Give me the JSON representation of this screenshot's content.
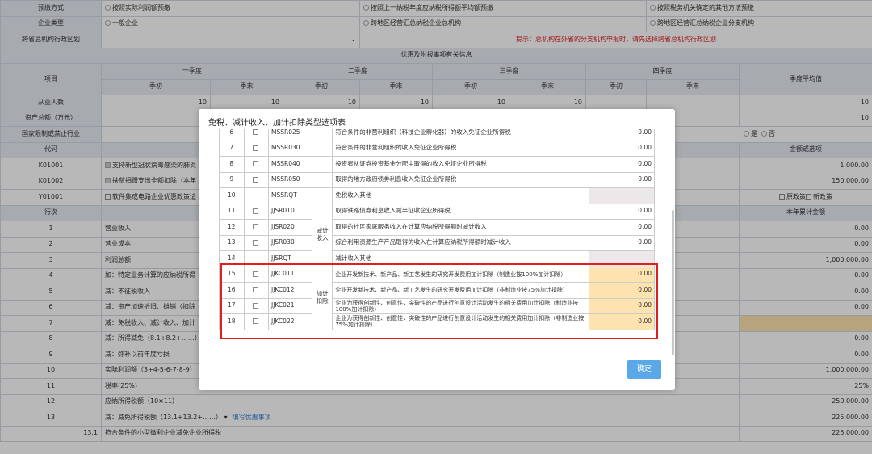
{
  "form": {
    "method_label": "预缴方式",
    "method_opts": [
      "按照实际利润额预缴",
      "按照上一纳税年度应纳税所得额平均额预缴",
      "按照税务机关确定的其他方法预缴"
    ],
    "type_label": "企业类型",
    "type_opts": [
      "一般企业",
      "跨地区经营汇总纳税企业总机构",
      "跨地区经营汇总纳税企业分支机构"
    ],
    "region_label": "跨省总机构行政区划",
    "region_hint": "提示：总机构在外省的分支机构申报时，请先选择跨省总机构行政区划",
    "section_title": "优惠及附报事项有关信息",
    "item_label": "项目",
    "quarters": [
      "一季度",
      "二季度",
      "三季度",
      "四季度"
    ],
    "q_begin": "季初",
    "q_end": "季末",
    "q_avg": "季度平均值",
    "rows": [
      {
        "label": "从业人数",
        "vals": [
          "10",
          "10",
          "10",
          "10",
          "10",
          "10"
        ],
        "avg": "10"
      },
      {
        "label": "资产总额（万元）",
        "vals": [
          "",
          "",
          "",
          "",
          "",
          ""
        ],
        "avg": "10"
      }
    ],
    "restricted_label": "国家限制或禁止行业",
    "restricted_yes": "是",
    "restricted_no": "否",
    "code_label": "代码",
    "amount_label": "金额或选项",
    "pref": [
      {
        "code": "K01001",
        "name": "支持新型冠状病毒感染的肺炎",
        "amt": "1,000.00"
      },
      {
        "code": "K01002",
        "name": "扶贫捐赠支出全额扣除（本年",
        "amt": "150,000.00"
      },
      {
        "code": "Y01001",
        "name": "软件集成电路企业优惠政策适",
        "amt": ""
      }
    ],
    "old_policy": "原政策",
    "new_policy": "新政策",
    "line_label": "行次",
    "cum_label": "本年累计金额",
    "lines": [
      {
        "no": "1",
        "name": "营业收入",
        "amt": "0.00"
      },
      {
        "no": "2",
        "name": "营业成本",
        "amt": "0.00"
      },
      {
        "no": "3",
        "name": "利润总额",
        "amt": "1,000,000.00"
      },
      {
        "no": "4",
        "name": "加：特定业务计算的应纳税所得",
        "amt": "0.00"
      },
      {
        "no": "5",
        "name": "减：不征税收入",
        "amt": "0.00"
      },
      {
        "no": "6",
        "name": "减：资产加速折旧、摊销（扣除",
        "amt": "0.00"
      },
      {
        "no": "7",
        "name": "减：免税收入、减计收入、加计",
        "amt": ""
      },
      {
        "no": "8",
        "name": "减：所得减免（8.1+8.2+……）",
        "amt": "0.00"
      },
      {
        "no": "9",
        "name": "减：弥补以前年度亏损",
        "amt": "0.00"
      },
      {
        "no": "10",
        "name": "实际利润额（3+4-5-6-7-8-9）",
        "amt": "1,000,000.00"
      },
      {
        "no": "11",
        "name": "税率(25%)",
        "amt": "25%"
      },
      {
        "no": "12",
        "name": "应纳所得税额（10×11）",
        "amt": "250,000.00"
      },
      {
        "no": "13",
        "name": "减：减免所得税额（13.1+13.2+……）",
        "amt": "225,000.00"
      },
      {
        "no": "13.1",
        "name": "符合条件的小型微利企业减免企业所得税",
        "amt": "225,000.00"
      }
    ],
    "fill_link": "填写优惠事项"
  },
  "dialog": {
    "title": "免税、减计收入、加计扣除类型选项表",
    "group_reduce": "减计收入",
    "group_add": "加计扣除",
    "confirm": "确定",
    "rows": [
      {
        "no": "6",
        "code": "MSSR025",
        "name": "符合条件的非营利组织（科技企业孵化器）的收入免征企业所得税",
        "amt": "0.00",
        "check": true
      },
      {
        "no": "7",
        "code": "MSSR030",
        "name": "符合条件的非营利组织的收入免征企业所得税",
        "amt": "0.00",
        "check": true
      },
      {
        "no": "8",
        "code": "MSSR040",
        "name": "投资者从证券投资基金分配中取得的收入免征企业所得税",
        "amt": "0.00",
        "check": true
      },
      {
        "no": "9",
        "code": "MSSR050",
        "name": "取得的地方政府债券利息收入免征企业所得税",
        "amt": "0.00",
        "check": true
      },
      {
        "no": "10",
        "code": "MSSRQT",
        "name": "免税收入其他",
        "amt": "",
        "check": false
      },
      {
        "no": "11",
        "code": "JJSR010",
        "name": "取得铁路债券利息收入减半征收企业所得税",
        "amt": "0.00",
        "check": true
      },
      {
        "no": "12",
        "code": "JJSR020",
        "name": "取得的社区家庭服务收入在计算应纳税所得额时减计收入",
        "amt": "0.00",
        "check": true
      },
      {
        "no": "13",
        "code": "JJSR030",
        "name": "综合利用资源生产产品取得的收入在计算应纳税所得额时减计收入",
        "amt": "0.00",
        "check": true
      },
      {
        "no": "14",
        "code": "JJSRQT",
        "name": "减计收入其他",
        "amt": "",
        "check": false
      },
      {
        "no": "15",
        "code": "JJKC011",
        "name": "企业开发新技术、新产品、新工艺发生的研究开发费用加计扣除（制造业按100%加计扣除）",
        "amt": "0.00",
        "check": true
      },
      {
        "no": "16",
        "code": "JJKC012",
        "name": "企业开发新技术、新产品、新工艺发生的研究开发费用加计扣除（非制造业按75%加计扣除）",
        "amt": "0.00",
        "check": true
      },
      {
        "no": "17",
        "code": "JJKC021",
        "name": "企业为获得创新性、创意性、突破性的产品进行创意设计活动发生的相关费用加计扣除（制造业按100%加计扣除）",
        "amt": "0.00",
        "check": true
      },
      {
        "no": "18",
        "code": "JJKC022",
        "name": "企业为获得创新性、创意性、突破性的产品进行创意设计活动发生的相关费用加计扣除（非制造业按75%加计扣除）",
        "amt": "0.00",
        "check": true
      }
    ]
  }
}
